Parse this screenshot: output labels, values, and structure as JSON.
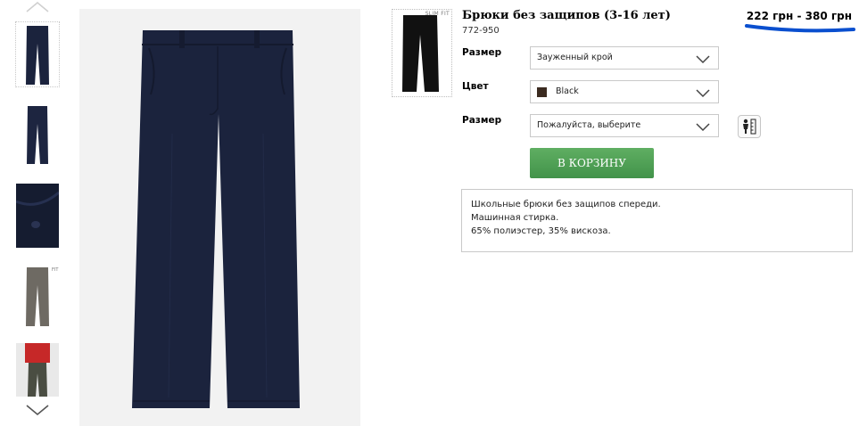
{
  "gallery": {
    "thumbnails": [
      {
        "name": "front-view",
        "selected": true
      },
      {
        "name": "front-view-alt",
        "selected": false
      },
      {
        "name": "button-detail",
        "selected": false
      },
      {
        "name": "grey-variant",
        "selected": false
      },
      {
        "name": "worn-by-model",
        "selected": false
      }
    ],
    "up_icon": "chevron-up-icon",
    "down_icon": "chevron-down-icon",
    "main_image": "navy-trousers",
    "main_color": "#1b233d"
  },
  "product": {
    "title": "Брюки без защипов (3-16 лет)",
    "code": "772-950",
    "price": "222 грн - 380 грн",
    "price_marker_color": "#0a4fcf",
    "mini_thumb_badge": "SLIM FIT"
  },
  "options": {
    "fit_label": "Размер",
    "fit_value": "Зауженный крой",
    "color_label": "Цвет",
    "color_value": "Black",
    "color_swatch": "#3b2b20",
    "size_label": "Размер",
    "size_value": "Пожалуйста, выберите",
    "size_guide_icon": "size-guide-icon"
  },
  "cart": {
    "label": "В КОРЗИНУ",
    "color": "#4e9f54"
  },
  "description": {
    "lines": [
      "Школьные брюки без защипов спереди.",
      "Машинная стирка.",
      "65% полиэстер, 35% вискоза."
    ]
  }
}
